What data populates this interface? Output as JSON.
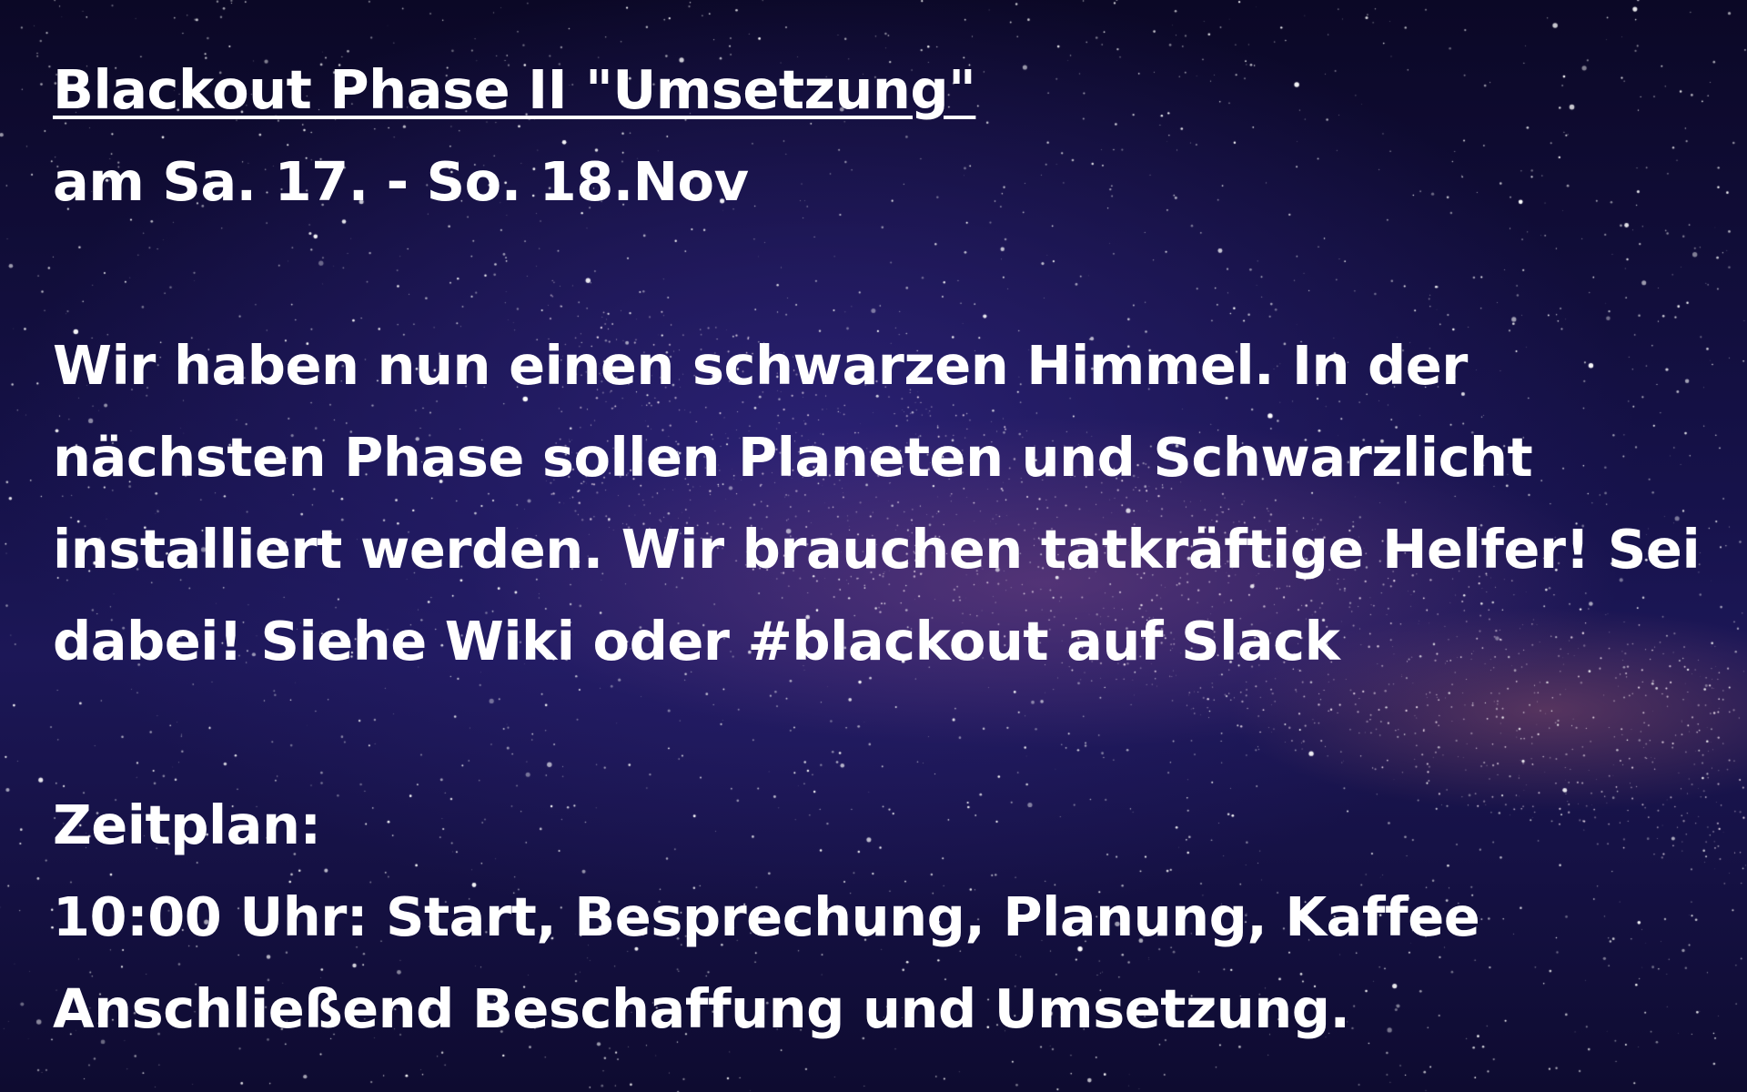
{
  "poster": {
    "title": "Blackout Phase II \"Umsetzung\"",
    "date": "am Sa. 17. - So. 18.Nov",
    "body_lines": [
      "Wir haben nun einen schwarzen Himmel. In der",
      "nächsten Phase sollen Planeten und Schwarzlicht",
      "installiert werden. Wir brauchen tatkräftige Helfer! Sei",
      "dabei! Siehe Wiki oder #blackout auf Slack"
    ],
    "schedule_heading": "Zeitplan:",
    "schedule_items": [
      "10:00 Uhr: Start, Besprechung, Planung, Kaffee",
      "Anschließend Beschaffung und Umsetzung."
    ]
  },
  "colors": {
    "text": "#ffffff",
    "sky_dark": "#0b0826",
    "sky_mid": "#1c1757",
    "milky_way": "#a05a6e"
  }
}
